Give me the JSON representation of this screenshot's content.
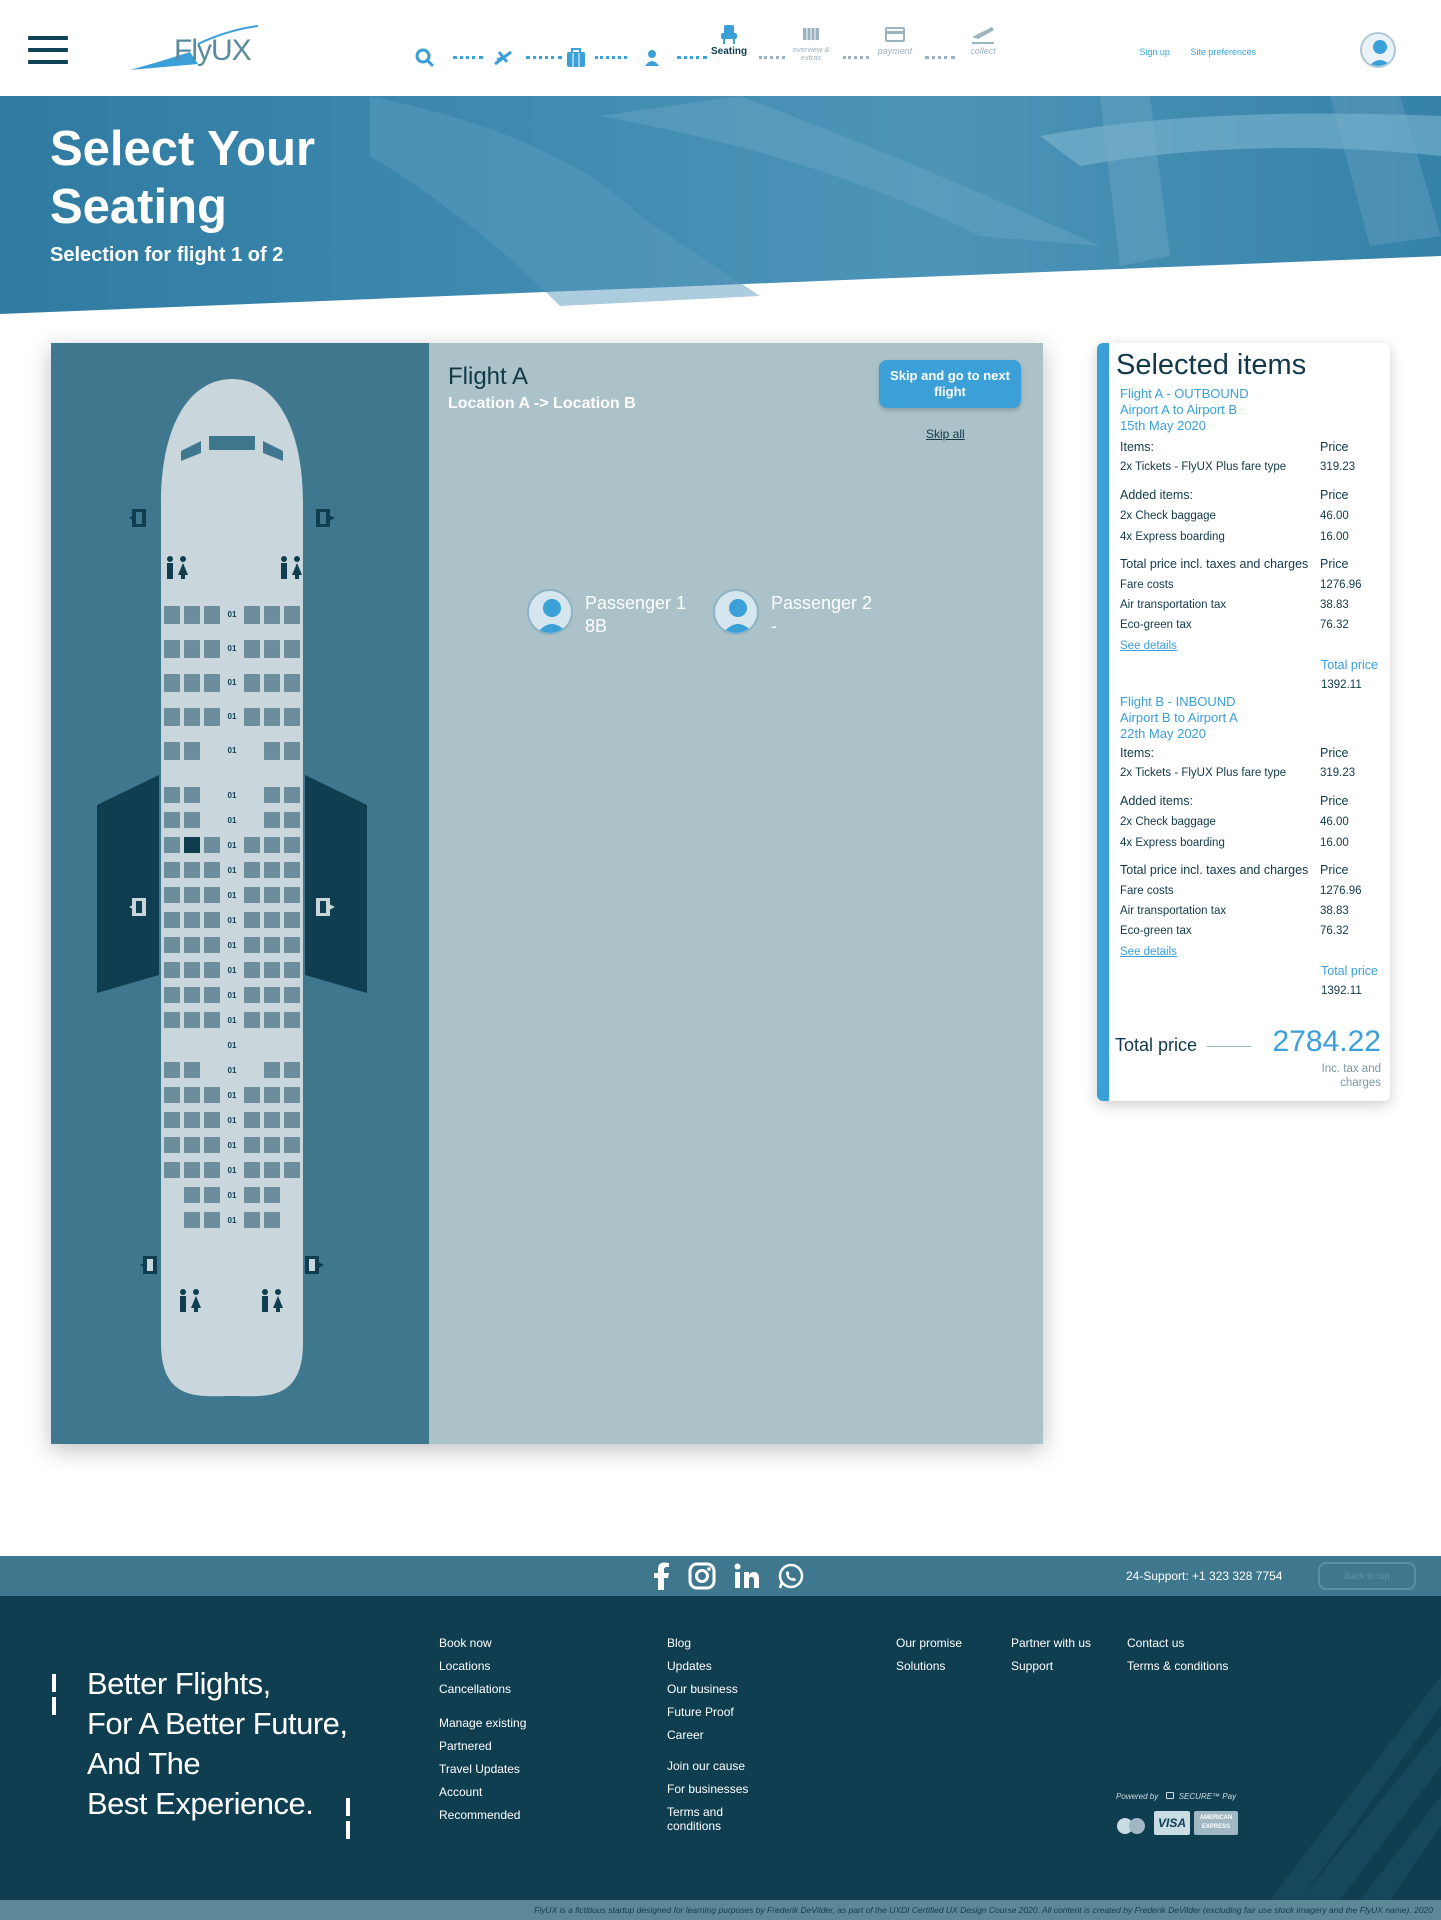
{
  "header": {
    "logo_text": "FlyUX",
    "steps": [
      {
        "label": "",
        "icon": "search-icon"
      },
      {
        "label": "",
        "icon": "flight-icon"
      },
      {
        "label": "",
        "icon": "luggage-icon"
      },
      {
        "label": "",
        "icon": "passenger-icon"
      },
      {
        "label": "Seating",
        "icon": "seat-icon"
      },
      {
        "label": "overview & extras",
        "icon": "barcode-icon"
      },
      {
        "label": "payment",
        "icon": "card-icon"
      },
      {
        "label": "collect",
        "icon": "takeoff-icon"
      }
    ],
    "sign_up": "Sign up",
    "site_preferences": "Site preferences"
  },
  "hero": {
    "title": "Select Your Seating",
    "subtitle": "Selection for flight 1 of 2"
  },
  "flight": {
    "title": "Flight A",
    "route": "Location A -> Location B",
    "skip_button": "Skip and go to next flight",
    "skip_all": "Skip all",
    "passengers": [
      {
        "name": "Passenger 1",
        "seat": "8B"
      },
      {
        "name": "Passenger 2",
        "seat": "-"
      }
    ],
    "row_label": "01"
  },
  "selected": {
    "title": "Selected items",
    "outbound": {
      "title": "Flight A - OUTBOUND",
      "route": "Airport A to Airport B",
      "date": "15th May 2020",
      "items_h": "Items:",
      "price_h": "Price",
      "items": [
        {
          "label": "2x Tickets - FlyUX Plus fare type",
          "price": "319.23"
        }
      ],
      "added_h": "Added items:",
      "added": [
        {
          "label": "2x Check baggage",
          "price": "46.00"
        },
        {
          "label": "4x Express boarding",
          "price": "16.00"
        }
      ],
      "total_h": "Total price incl. taxes and charges",
      "taxes": [
        {
          "label": "Fare costs",
          "price": "1276.96"
        },
        {
          "label": "Air transportation tax",
          "price": "38.83"
        },
        {
          "label": "Eco-green tax",
          "price": "76.32"
        }
      ],
      "see_details": "See details",
      "total_label": "Total price",
      "total": "1392.11"
    },
    "inbound": {
      "title": "Flight B - INBOUND",
      "route": "Airport B to Airport A",
      "date": "22th May 2020",
      "items_h": "Items:",
      "price_h": "Price",
      "items": [
        {
          "label": "2x Tickets - FlyUX Plus fare type",
          "price": "319.23"
        }
      ],
      "added_h": "Added items:",
      "added": [
        {
          "label": "2x Check baggage",
          "price": "46.00"
        },
        {
          "label": "4x Express boarding",
          "price": "16.00"
        }
      ],
      "total_h": "Total price incl. taxes and charges",
      "taxes": [
        {
          "label": "Fare costs",
          "price": "1276.96"
        },
        {
          "label": "Air transportation tax",
          "price": "38.83"
        },
        {
          "label": "Eco-green tax",
          "price": "76.32"
        }
      ],
      "see_details": "See details",
      "total_label": "Total price",
      "total": "1392.11"
    },
    "grand_label": "Total price",
    "grand_total": "2784.22",
    "grand_note": "Inc. tax and charges"
  },
  "footer": {
    "social": [
      "facebook-icon",
      "instagram-icon",
      "linkedin-icon",
      "whatsapp-icon"
    ],
    "support": "24-Support: +1 323 328 7754",
    "back_to_top": "Back to top",
    "slogan": [
      "Better Flights,",
      "For A Better Future,",
      "And The",
      "Best Experience."
    ],
    "col1": [
      "Book now",
      "Locations",
      "Cancellations",
      "Manage existing",
      "Partnered",
      "Travel Updates",
      "Account",
      "Recommended"
    ],
    "col2": [
      "Blog",
      "Updates",
      "Our business",
      "Future Proof",
      "Career",
      "Join our cause",
      "For businesses",
      "Terms and",
      "conditions"
    ],
    "col3": [
      "Our promise",
      "Solutions"
    ],
    "col4": [
      "Partner with us",
      "Support"
    ],
    "col5": [
      "Contact us",
      "Terms & conditions"
    ],
    "powered": "Powered by",
    "powered_brand": "SECURE™ Pay",
    "cards": [
      "VISA",
      "AMERICAN EXPRESS"
    ],
    "copyright": "FlyUX is a fictitious startup designed for learning purposes by Frederik DeVilder, as part of the UXDI Certified UX Design Course 2020. All content is created by Frederik DeVilder (excluding fair use stock imagery and the FlyUX name). 2020"
  },
  "colors": {
    "accent": "#3b9fd8",
    "dark": "#0f3e50",
    "panel": "#aac2c8",
    "plane_bg": "#3f778f"
  }
}
